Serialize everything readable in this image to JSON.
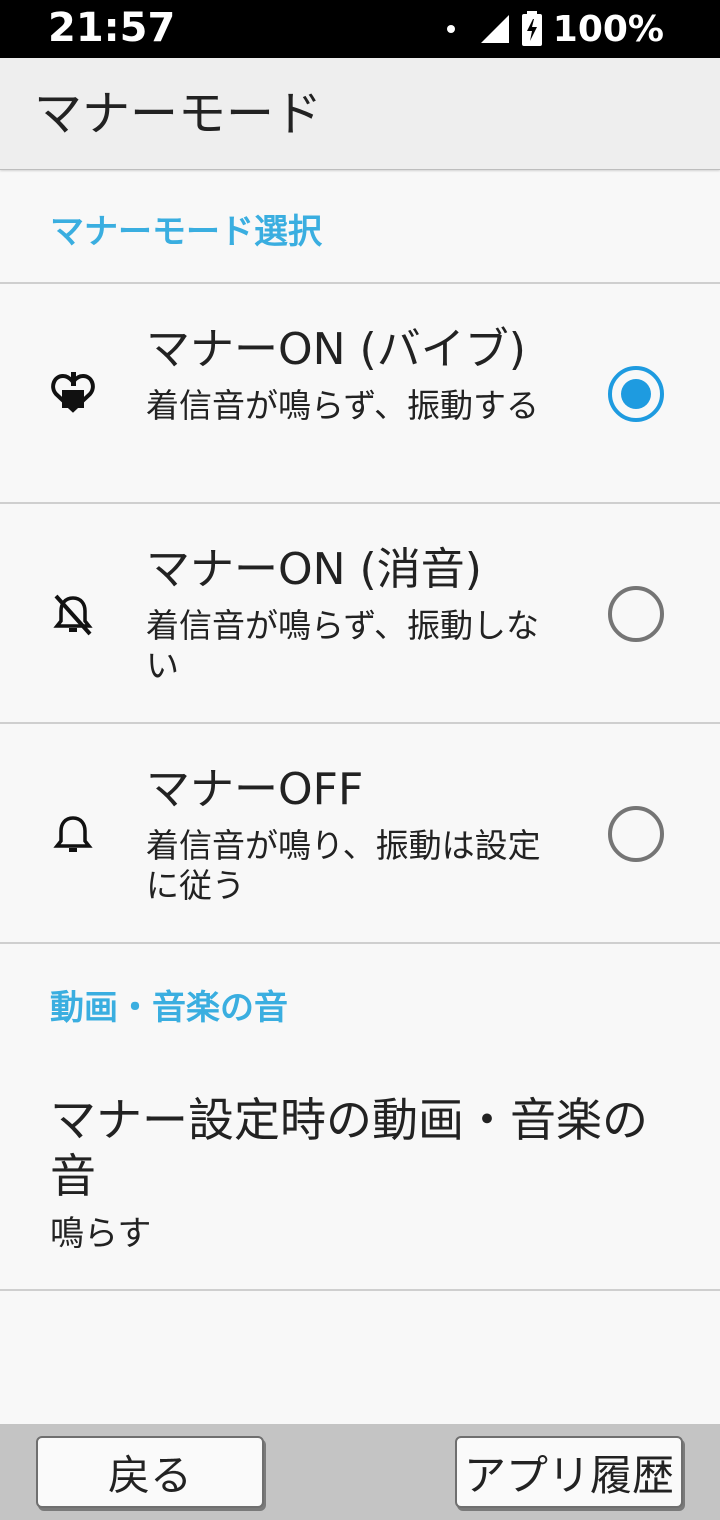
{
  "status_bar": {
    "time": "21:57",
    "battery": "100%"
  },
  "app_bar": {
    "title": "マナーモード"
  },
  "sections": {
    "manner_select": "マナーモード選択",
    "media_sound": "動画・音楽の音"
  },
  "options": [
    {
      "title": "マナーON (バイブ)",
      "summary": "着信音が鳴らず、振動する",
      "icon": "vibrate-icon",
      "checked": true
    },
    {
      "title": "マナーON (消音)",
      "summary": "着信音が鳴らず、振動しない",
      "icon": "bell-off-icon",
      "checked": false
    },
    {
      "title": "マナーOFF",
      "summary": "着信音が鳴り、振動は設定に従う",
      "icon": "bell-icon",
      "checked": false
    }
  ],
  "media_setting": {
    "title": "マナー設定時の動画・音楽の音",
    "summary": "鳴らす"
  },
  "soft_keys": {
    "back": "戻る",
    "app_history": "アプリ履歴"
  },
  "colors": {
    "accent": "#1e9be0",
    "section_header": "#3aaee0"
  }
}
